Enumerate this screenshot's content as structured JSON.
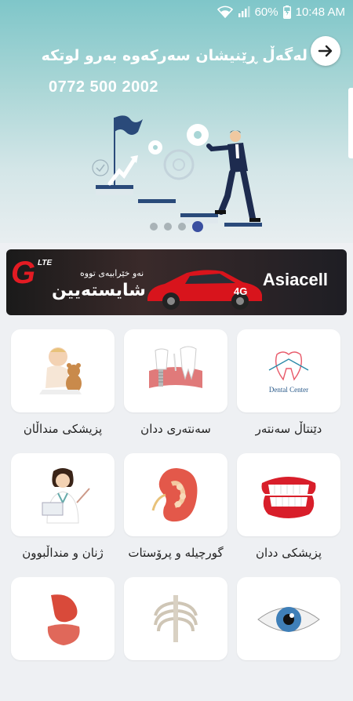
{
  "status_bar": {
    "battery": "60%",
    "time": "10:48 AM"
  },
  "hero": {
    "title": "لەگەڵ ڕێنیشان سەرکەوە بەرو لوتکە",
    "phone": "0772 500 2002",
    "slides": [
      {},
      {},
      {},
      {
        "active": true
      }
    ]
  },
  "banner": {
    "logo": "G",
    "logo_sup": "LTE",
    "line1": "نەو خێرابیەی تووە",
    "line2": "شایستەیین",
    "brand": "Asiacell",
    "car_number": "4G"
  },
  "categories": [
    {
      "label": "پزیشکی منداڵان",
      "icon": "baby-teddy-icon"
    },
    {
      "label": "سەنتەری ددان",
      "icon": "dental-implant-icon"
    },
    {
      "label": "دێنتاڵ سەنتەر",
      "icon": "dental-center-logo",
      "logo_text": "Dental Center"
    },
    {
      "label": "ژنان و منداڵبوون",
      "icon": "female-doctor-icon"
    },
    {
      "label": "گورچیلە و پرۆستات",
      "icon": "kidney-icon"
    },
    {
      "label": "پزیشکی ددان",
      "icon": "teeth-icon"
    },
    {
      "label": "",
      "icon": "stomach-icon"
    },
    {
      "label": "",
      "icon": "ribcage-icon"
    },
    {
      "label": "",
      "icon": "eye-icon"
    }
  ]
}
